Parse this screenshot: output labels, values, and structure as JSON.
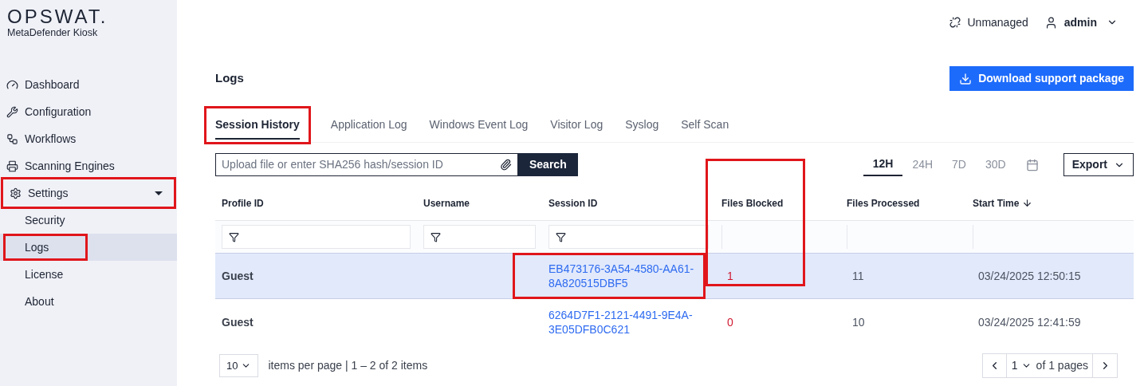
{
  "brand": {
    "logo": "OPSWAT.",
    "product": "MetaDefender Kiosk"
  },
  "sidebar": {
    "items": [
      {
        "kind": "item",
        "label": "Dashboard",
        "selected": false,
        "highlighted": false
      },
      {
        "kind": "item",
        "label": "Configuration",
        "selected": false,
        "highlighted": false
      },
      {
        "kind": "item",
        "label": "Workflows",
        "selected": false,
        "highlighted": false
      },
      {
        "kind": "item",
        "label": "Scanning Engines",
        "selected": false,
        "highlighted": false
      },
      {
        "kind": "group",
        "label": "Settings",
        "expanded": true,
        "selected": false,
        "highlighted": true,
        "children": [
          {
            "label": "Security",
            "selected": false,
            "highlighted": false
          },
          {
            "label": "Logs",
            "selected": true,
            "highlighted": true
          },
          {
            "label": "License",
            "selected": false,
            "highlighted": false
          },
          {
            "label": "About",
            "selected": false,
            "highlighted": false
          }
        ]
      }
    ]
  },
  "topbar": {
    "status": "Unmanaged",
    "user": "admin"
  },
  "page": {
    "title": "Logs",
    "download_button": "Download support package"
  },
  "tabs": [
    {
      "label": "Session History",
      "selected": true,
      "highlighted": true
    },
    {
      "label": "Application Log",
      "selected": false,
      "highlighted": false
    },
    {
      "label": "Windows Event Log",
      "selected": false,
      "highlighted": false
    },
    {
      "label": "Visitor Log",
      "selected": false,
      "highlighted": false
    },
    {
      "label": "Syslog",
      "selected": false,
      "highlighted": false
    },
    {
      "label": "Self Scan",
      "selected": false,
      "highlighted": false
    }
  ],
  "search": {
    "placeholder": "Upload file or enter SHA256 hash/session ID",
    "button": "Search"
  },
  "ranges": [
    {
      "label": "12H",
      "selected": true
    },
    {
      "label": "24H",
      "selected": false
    },
    {
      "label": "7D",
      "selected": false
    },
    {
      "label": "30D",
      "selected": false
    }
  ],
  "export_button": "Export",
  "table": {
    "columns": [
      {
        "label": "Profile ID",
        "filter": true,
        "sorted": false,
        "highlighted": false
      },
      {
        "label": "Username",
        "filter": true,
        "sorted": false,
        "highlighted": false
      },
      {
        "label": "Session ID",
        "filter": true,
        "sorted": false,
        "highlighted": false
      },
      {
        "label": "Files Blocked",
        "filter": false,
        "sorted": false,
        "highlighted": true
      },
      {
        "label": "Files Processed",
        "filter": false,
        "sorted": false,
        "highlighted": false
      },
      {
        "label": "Start Time",
        "filter": false,
        "sorted": true,
        "highlighted": false
      }
    ],
    "rows": [
      {
        "selected": true,
        "profile_id": "Guest",
        "session_id": "EB473176-3A54-4580-AA61-8A820515DBF5",
        "session_highlighted": true,
        "files_blocked": "1",
        "files_processed": "11",
        "start_time": "03/24/2025 12:50:15"
      },
      {
        "selected": false,
        "profile_id": "Guest",
        "session_id": "6264D7F1-2121-4491-9E4A-3E05DFB0C621",
        "session_highlighted": false,
        "files_blocked": "0",
        "files_processed": "10",
        "start_time": "03/24/2025 12:41:59"
      }
    ]
  },
  "pagination": {
    "page_size": "10",
    "summary": "items per page | 1 – 2 of 2 items",
    "page": "1",
    "of_pages": "of 1 pages"
  }
}
